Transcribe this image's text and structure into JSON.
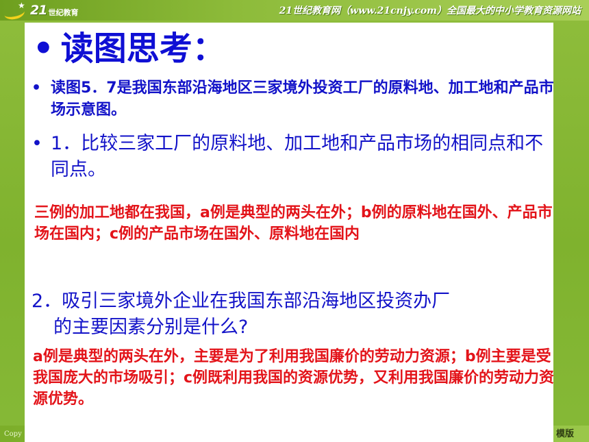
{
  "header": {
    "logo_text": "21",
    "logo_sub": "世纪教育",
    "site_banner": "21世纪教育网（www.21cnjy.com）全国最大的中小学教育资源网站"
  },
  "footer": {
    "copyright": "Copy",
    "edition": "模版"
  },
  "slide": {
    "title": "读图思考：",
    "bullet_symbol": "•",
    "intro": "读图5．7是我国东部沿海地区三家境外投资工厂的原料地、加工地和产品市场示意图。",
    "question1": "1．比较三家工厂的原料地、加工地和产品市场的相同点和不同点。",
    "answer1": "三例的加工地都在我国，a例是典型的两头在外；b例的原料地在国外、产品市场在国内；c例的产品市场在国外、原料地在国内",
    "question2_line1": "2．吸引三家境外企业在我国东部沿海地区投资办厂",
    "question2_line2": "的主要因素分别是什么?",
    "answer2": "a例是典型的两头在外，主要是为了利用我国廉价的劳动力资源；b例主要是受我国庞大的市场吸引；c例既利用我国的资源优势，又利用我国廉价的劳动力资源优势。"
  },
  "colors": {
    "heading": "#0f0fd4",
    "body_text": "#1212c8",
    "answer_text": "#e3141a",
    "frame_green": "#86b937"
  }
}
